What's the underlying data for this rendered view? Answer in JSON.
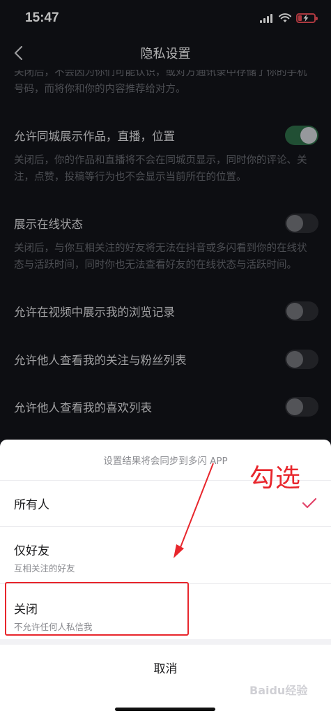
{
  "status_bar": {
    "time": "15:47"
  },
  "nav": {
    "title": "隐私设置"
  },
  "settings": {
    "top_desc": "关闭后，不会因为你们可能认识，或对方通讯录中存储了你的手机号码，而将你和你的内容推荐给对方。",
    "items": [
      {
        "label": "允许同城展示作品，直播，位置",
        "toggle_on": true,
        "desc": "关闭后，你的作品和直播将不会在同城页显示，同时你的评论、关注，点赞，投稿等行为也不会显示当前所在的位置。"
      },
      {
        "label": "展示在线状态",
        "toggle_on": false,
        "desc": "关闭后，与你互相关注的好友将无法在抖音或多闪看到你的在线状态与活跃时间，同时你也无法查看好友的在线状态与活跃时间。"
      },
      {
        "label": "允许在视频中展示我的浏览记录",
        "toggle_on": false
      },
      {
        "label": "允许他人查看我的关注与粉丝列表",
        "toggle_on": false
      },
      {
        "label": "允许他人查看我的喜欢列表",
        "toggle_on": false
      }
    ]
  },
  "sheet": {
    "header": "设置结果将会同步到多闪 APP",
    "options": [
      {
        "label": "所有人",
        "selected": true
      },
      {
        "label": "仅好友",
        "sub": "互相关注的好友"
      },
      {
        "label": "关闭",
        "sub": "不允许任何人私信我"
      }
    ],
    "cancel": "取消"
  },
  "annotation": {
    "text": "勾选",
    "color": "#e8262c"
  },
  "watermark": "Baidu经验",
  "colors": {
    "toggle_on": "#2d6a46",
    "check": "#e2456a"
  }
}
